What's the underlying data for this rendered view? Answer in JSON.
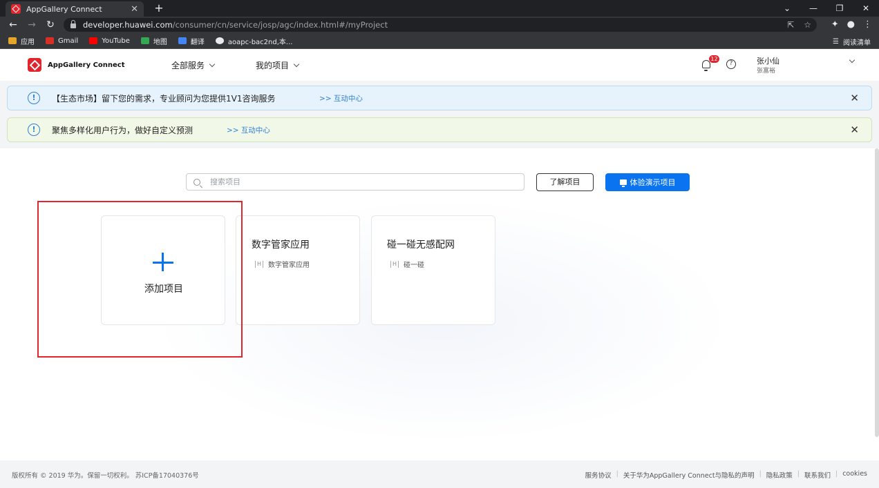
{
  "browser": {
    "tab_title": "AppGallery Connect",
    "url_host": "developer.huawei.com",
    "url_path": "/consumer/cn/service/josp/agc/index.html#/myProject",
    "bookmarks": [
      {
        "label": "应用",
        "color": "#e3a52a"
      },
      {
        "label": "Gmail",
        "color": "#d93025"
      },
      {
        "label": "YouTube",
        "color": "#ff0000"
      },
      {
        "label": "地图",
        "color": "#34a853"
      },
      {
        "label": "翻译",
        "color": "#4285f4"
      },
      {
        "label": "aoapc-bac2nd,本...",
        "color": "#e8eaed"
      }
    ],
    "reading_list": "阅读清单"
  },
  "header": {
    "logo_text": "AppGallery Connect",
    "menu_all_services": "全部服务",
    "menu_my_projects": "我的项目",
    "notification_count": "12",
    "help_symbol": "?",
    "user_name": "张小仙",
    "user_sub": "张富裕"
  },
  "notices": [
    {
      "text": "【生态市场】留下您的需求，专业顾问为您提供1V1咨询服务",
      "link": ">> 互动中心"
    },
    {
      "text": "聚焦多样化用户行为，做好自定义预测",
      "link": ">> 互动中心"
    }
  ],
  "toolbar": {
    "search_placeholder": "搜索项目",
    "learn_button": "了解项目",
    "demo_button": "体验演示项目"
  },
  "cards": {
    "add_label": "添加项目",
    "projects": [
      {
        "title": "数字管家应用",
        "app": "数字管家应用"
      },
      {
        "title": "碰一碰无感配网",
        "app": "碰一碰"
      }
    ]
  },
  "footer": {
    "copyright": "版权所有 © 2019 华为。保留一切权利。 苏ICP备17040376号",
    "links": [
      "服务协议",
      "关于华为AppGallery Connect与隐私的声明",
      "隐私政策",
      "联系我们",
      "cookies"
    ]
  },
  "colors": {
    "brand_red": "#e0262c",
    "primary_blue": "#0a74f0",
    "link_blue": "#2f7fd6"
  }
}
